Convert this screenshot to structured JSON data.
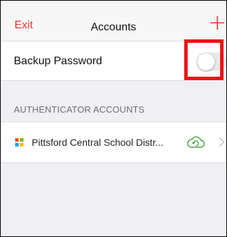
{
  "navbar": {
    "exit_label": "Exit",
    "title": "Accounts",
    "add_icon": "plus-icon"
  },
  "backup": {
    "label": "Backup Password",
    "toggle_on": false
  },
  "section": {
    "header": "AUTHENTICATOR ACCOUNTS"
  },
  "accounts": [
    {
      "name": "Pittsford Central School Distr...",
      "logo_icon": "microsoft-logo-icon",
      "sync_icon": "cloud-sync-icon",
      "nav_icon": "chevron-right-icon"
    }
  ],
  "colors": {
    "accent": "#e8342c",
    "cloud": "#3fa33a",
    "highlight": "#ee1111"
  }
}
